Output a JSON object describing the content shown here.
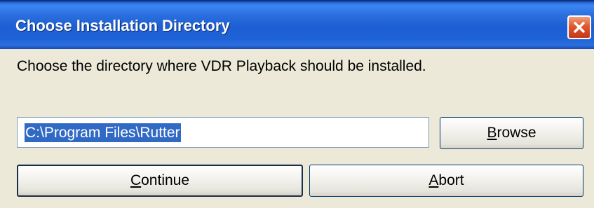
{
  "window": {
    "title": "Choose Installation Directory",
    "close_icon": "close-icon"
  },
  "instruction": "Choose the directory where VDR Playback should be installed.",
  "path_field": {
    "value": "C:\\Program Files\\Rutter",
    "selected": true
  },
  "buttons": {
    "browse": {
      "accel": "B",
      "rest": "rowse"
    },
    "continue": {
      "accel": "C",
      "rest": "ontinue"
    },
    "abort": {
      "accel": "A",
      "rest": "bort"
    }
  },
  "colors": {
    "titlebar": "#1f62d8",
    "dialog_bg": "#ece9d8",
    "selection": "#316ac5",
    "close_button": "#e0572b"
  }
}
